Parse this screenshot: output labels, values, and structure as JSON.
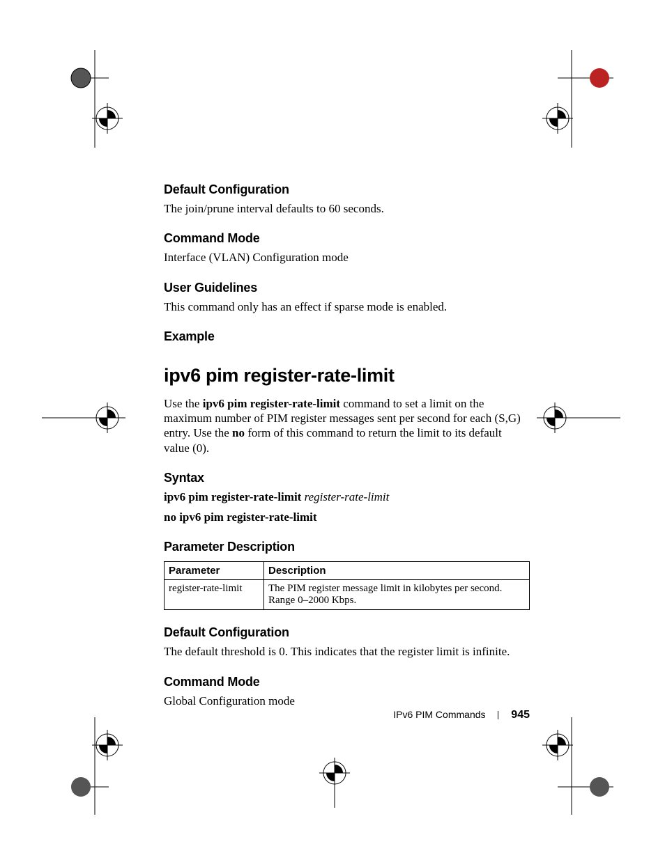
{
  "sections": {
    "defaultConfig1": {
      "heading": "Default Configuration",
      "text": "The join/prune interval defaults to 60 seconds."
    },
    "commandMode1": {
      "heading": "Command Mode",
      "text": "Interface (VLAN) Configuration mode"
    },
    "userGuidelines": {
      "heading": "User Guidelines",
      "text": "This command only has an effect if sparse mode is enabled."
    },
    "example": {
      "heading": "Example"
    },
    "commandTitle": "ipv6 pim register-rate-limit",
    "intro": {
      "prefix": "Use the ",
      "bold1": "ipv6 pim register-rate-limit",
      "mid": " command to set a limit on the maximum number of PIM register messages sent per second for each (S,G) entry. Use the ",
      "bold2": "no",
      "suffix": " form of this command to return the limit to its default value (0)."
    },
    "syntax": {
      "heading": "Syntax",
      "line1_bold": "ipv6 pim register-rate-limit ",
      "line1_italic": "register-rate-limit",
      "line2_bold": "no ipv6 pim register-rate-limit"
    },
    "paramDesc": {
      "heading": "Parameter Description",
      "table": {
        "headers": {
          "param": "Parameter",
          "desc": "Description"
        },
        "rows": [
          {
            "param": "register-rate-limit",
            "desc": "The PIM register message limit in kilobytes per second. Range 0–2000 Kbps."
          }
        ]
      }
    },
    "defaultConfig2": {
      "heading": "Default Configuration",
      "text": "The default threshold is 0. This indicates that the register limit is infinite."
    },
    "commandMode2": {
      "heading": "Command Mode",
      "text": "Global Configuration mode"
    }
  },
  "footer": {
    "section": "IPv6 PIM Commands",
    "page": "945"
  }
}
